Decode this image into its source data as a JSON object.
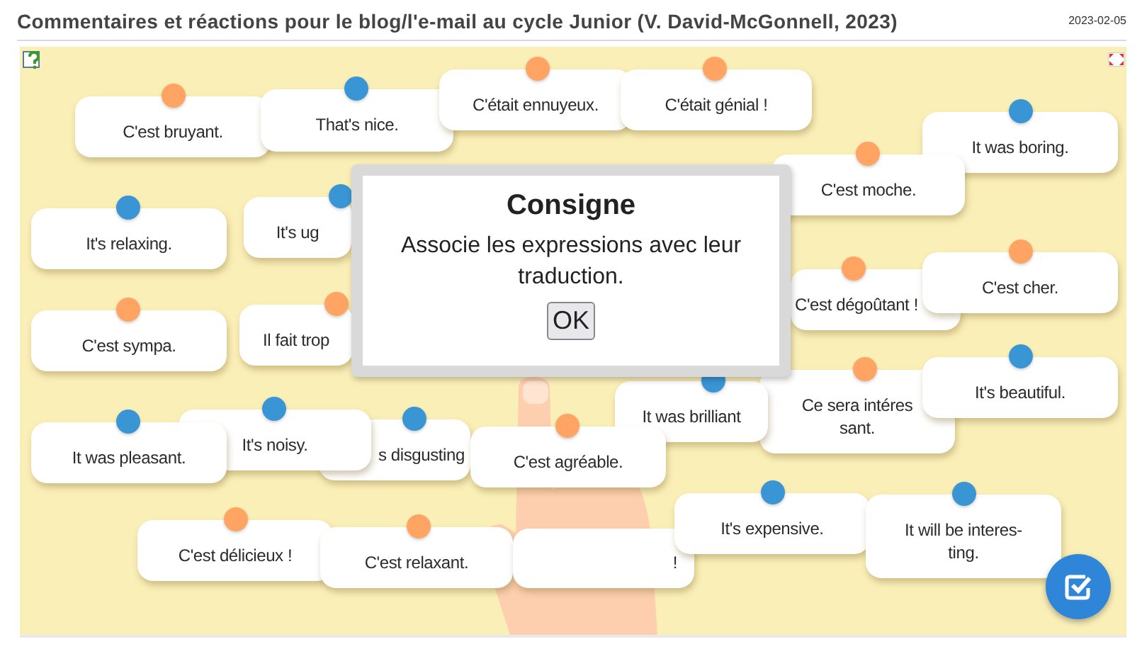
{
  "header": {
    "title": "Commentaires et réactions pour le blog/l'e-mail au cycle Junior (V. David-McGonnell, 2023)",
    "date": "2023-02-05"
  },
  "cards": [
    {
      "text": "C'est bruyant.",
      "color": "#ffa463"
    },
    {
      "text": "That's nice.",
      "color": "#3a95d4"
    },
    {
      "text": "C'était ennuyeux.",
      "color": "#ffa463"
    },
    {
      "text": "C'était génial !",
      "color": "#ffa463"
    },
    {
      "text": "It was boring.",
      "color": "#3a95d4"
    },
    {
      "text": "C'est moche.",
      "color": "#ffa463"
    },
    {
      "text": "It's relaxing.",
      "color": "#3a95d4"
    },
    {
      "text": "It's ug",
      "color": "#3a95d4"
    },
    {
      "text": "C'est sympa.",
      "color": "#ffa463"
    },
    {
      "text": "Il fait trop",
      "color": "#ffa463"
    },
    {
      "text": "C'est dégoûtant !",
      "color": "#ffa463"
    },
    {
      "text": "C'est cher.",
      "color": "#ffa463"
    },
    {
      "text": "Ce sera intéres\nsant.",
      "color": "#ffa463"
    },
    {
      "text": "It's beautiful.",
      "color": "#3a95d4"
    },
    {
      "text": "It was brilliant",
      "color": "#3a95d4"
    },
    {
      "text": "It was pleasant.",
      "color": "#3a95d4"
    },
    {
      "text": "It's noisy.",
      "color": "#3a95d4"
    },
    {
      "text": "s disgusting",
      "color": "#3a95d4"
    },
    {
      "text": "C'est agréable.",
      "color": "#ffa463"
    },
    {
      "text": "C'est délicieux !",
      "color": "#ffa463"
    },
    {
      "text": "C'est relaxant.",
      "color": "#ffa463"
    },
    {
      "text": "!"
    },
    {
      "text": "It's expensive.",
      "color": "#3a95d4"
    },
    {
      "text": "It will be interes-\nting.",
      "color": "#3a95d4"
    }
  ],
  "dialog": {
    "title": "Consigne",
    "message": "Associe les expressions avec leur traduction.",
    "button": "OK"
  }
}
